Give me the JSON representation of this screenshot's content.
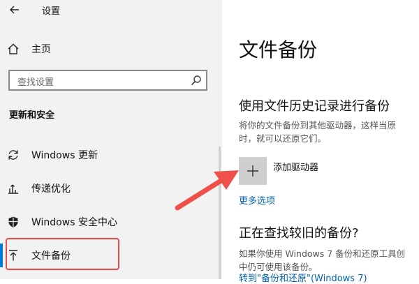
{
  "app": {
    "title": "设置"
  },
  "sidebar": {
    "home_label": "主页",
    "search_placeholder": "查找设置",
    "section_header": "更新和安全",
    "items": [
      {
        "label": "Windows 更新",
        "icon": "sync-icon"
      },
      {
        "label": "传递优化",
        "icon": "delivery-optimization-icon"
      },
      {
        "label": "Windows 安全中心",
        "icon": "shield-icon"
      },
      {
        "label": "文件备份",
        "icon": "backup-arrow-icon",
        "selected": true
      }
    ]
  },
  "main": {
    "page_title": "文件备份",
    "history": {
      "title": "使用文件历史记录进行备份",
      "desc_line1": "将你的文件备份到其他驱动器，这样当原",
      "desc_line2": "时，就可以还原它们。",
      "add_drive_label": "添加驱动器",
      "more_options": "更多选项"
    },
    "older": {
      "title": "正在查找较旧的备份?",
      "desc_line1": "如果你使用 Windows 7 备份和还原工具创",
      "desc_line2": "中仍可使用该备份。",
      "link": "转到\"备份和还原\"(Windows 7)"
    }
  },
  "colors": {
    "sidebar_bg": "#f2f2f2",
    "accent": "#0078d7",
    "highlight_border": "#e84a4a",
    "link": "#0063b1",
    "arrow": "#f0504a"
  }
}
